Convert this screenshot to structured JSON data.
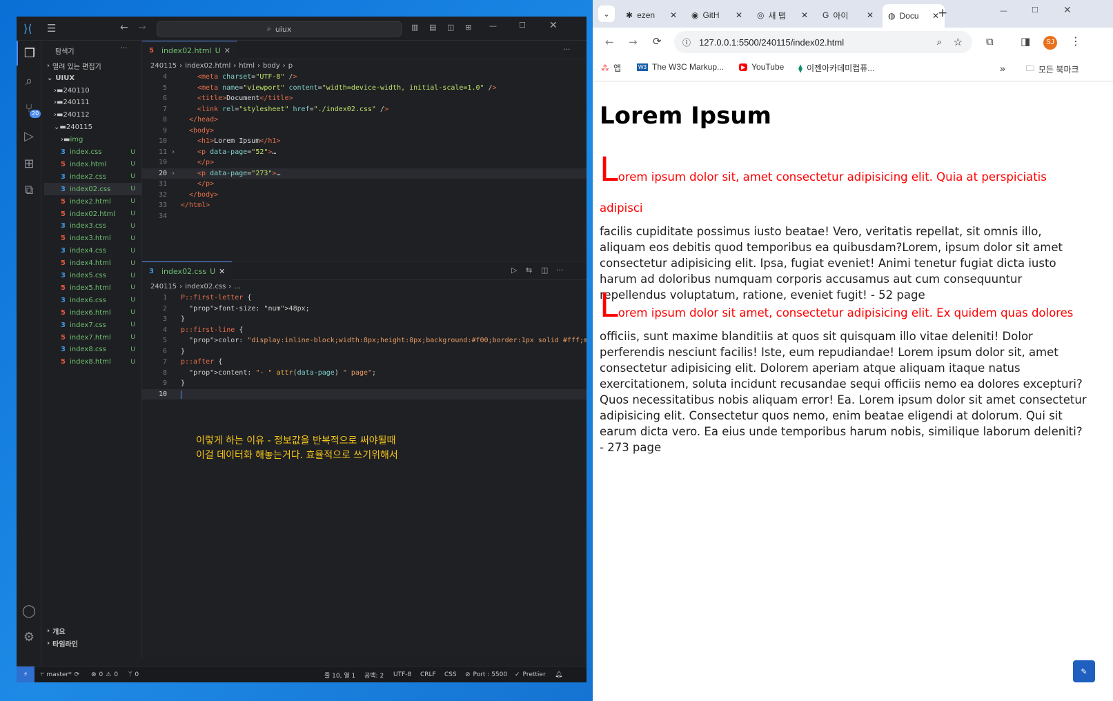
{
  "vscode": {
    "search_text": "uiux",
    "explorer_title": "탐색기",
    "open_editors": "열려 있는 편집기",
    "root": "UIUX",
    "tree": [
      {
        "name": "240110",
        "kind": "folder"
      },
      {
        "name": "240111",
        "kind": "folder"
      },
      {
        "name": "240112",
        "kind": "folder"
      },
      {
        "name": "240115",
        "kind": "folder-open"
      },
      {
        "name": "img",
        "kind": "folder"
      },
      {
        "name": "index.css",
        "kind": "css",
        "status": "U"
      },
      {
        "name": "index.html",
        "kind": "html",
        "status": "U"
      },
      {
        "name": "index2.css",
        "kind": "css",
        "status": "U"
      },
      {
        "name": "index02.css",
        "kind": "css",
        "status": "U"
      },
      {
        "name": "index2.html",
        "kind": "html",
        "status": "U"
      },
      {
        "name": "index02.html",
        "kind": "html",
        "status": "U"
      },
      {
        "name": "index3.css",
        "kind": "css",
        "status": "U"
      },
      {
        "name": "index3.html",
        "kind": "html",
        "status": "U"
      },
      {
        "name": "index4.css",
        "kind": "css",
        "status": "U"
      },
      {
        "name": "index4.html",
        "kind": "html",
        "status": "U"
      },
      {
        "name": "index5.css",
        "kind": "css",
        "status": "U"
      },
      {
        "name": "index5.html",
        "kind": "html",
        "status": "U"
      },
      {
        "name": "index6.css",
        "kind": "css",
        "status": "U"
      },
      {
        "name": "index6.html",
        "kind": "html",
        "status": "U"
      },
      {
        "name": "index7.css",
        "kind": "css",
        "status": "U"
      },
      {
        "name": "index7.html",
        "kind": "html",
        "status": "U"
      },
      {
        "name": "index8.css",
        "kind": "css",
        "status": "U"
      },
      {
        "name": "index8.html",
        "kind": "html",
        "status": "U"
      }
    ],
    "outline": "개요",
    "timeline": "타임라인",
    "editor1": {
      "tab": "index02.html",
      "tab_status": "U",
      "crumbs": [
        "240115",
        "index02.html",
        "html",
        "body",
        "p"
      ],
      "lines": [
        {
          "n": "4",
          "html": "<meta charset=\"UTF-8\" />"
        },
        {
          "n": "5",
          "html": "<meta name=\"viewport\" content=\"width=device-width, initial-scale=1.0\" />"
        },
        {
          "n": "6",
          "html": "<title>Document</title>"
        },
        {
          "n": "7",
          "html": "<link rel=\"stylesheet\" href=\"./index02.css\" />"
        },
        {
          "n": "8",
          "html": "</head>"
        },
        {
          "n": "9",
          "html": "<body>"
        },
        {
          "n": "10",
          "html": "<h1>Lorem Ipsum</h1>"
        },
        {
          "n": "11",
          "html": "<p data-page=\"52\">…"
        },
        {
          "n": "19",
          "html": "</p>"
        },
        {
          "n": "20",
          "html": "<p data-page=\"273\">…"
        },
        {
          "n": "31",
          "html": "</p>"
        },
        {
          "n": "32",
          "html": "</body>"
        },
        {
          "n": "33",
          "html": "</html>"
        },
        {
          "n": "34",
          "html": ""
        }
      ]
    },
    "editor2": {
      "tab": "index02.css",
      "tab_status": "U",
      "crumbs": [
        "240115",
        "index02.css",
        "..."
      ],
      "lines": [
        {
          "n": "1",
          "text": "P::first-letter {"
        },
        {
          "n": "2",
          "text": "  font-size: 48px;"
        },
        {
          "n": "3",
          "text": "}"
        },
        {
          "n": "4",
          "text": "p::first-line {"
        },
        {
          "n": "5",
          "text": "  color: #f00;"
        },
        {
          "n": "6",
          "text": "}"
        },
        {
          "n": "7",
          "text": "p::after {"
        },
        {
          "n": "8",
          "text": "  content: \"- \" attr(data-page) \" page\";"
        },
        {
          "n": "9",
          "text": "}"
        },
        {
          "n": "10",
          "text": ""
        }
      ]
    },
    "note_line1": "이렇게 하는 이유 - 정보값을 반복적으로 써야될때",
    "note_line2": "이걸 데이터화 해놓는거다. 효율적으로 쓰기위해서",
    "status": {
      "branch": "master*",
      "errors": "0",
      "warnings": "0",
      "ports": "0",
      "position": "줄 10, 열 1",
      "spaces": "공백: 2",
      "encoding": "UTF-8",
      "eol": "CRLF",
      "language": "CSS",
      "port": "Port : 5500",
      "formatter": "Prettier"
    },
    "scm_badge": "20"
  },
  "chrome": {
    "tabs": [
      "ezen",
      "GitH",
      "새 탭",
      "아이",
      "Docu"
    ],
    "url": "127.0.0.1:5500/240115/index02.html",
    "avatar": "SJ",
    "bookmarks": [
      "앱",
      "The W3C Markup...",
      "YouTube",
      "이젠아카데미컴퓨..."
    ],
    "all_bookmarks": "모든 북마크",
    "page": {
      "h1": "Lorem Ipsum",
      "p1_first": "L",
      "p1_line1": "orem ipsum dolor sit, amet consectetur adipisicing elit. Quia at perspiciatis adipisci",
      "p1_rest": "facilis cupiditate possimus iusto beatae! Vero, veritatis repellat, sit omnis illo, aliquam eos debitis quod temporibus ea quibusdam?Lorem, ipsum dolor sit amet consectetur adipisicing elit. Ipsa, fugiat eveniet! Animi tenetur fugiat dicta iusto harum ad doloribus numquam corporis accusamus aut cum consequuntur repellendus voluptatum, ratione, eveniet fugit! - 52 page",
      "p2_first": "L",
      "p2_line1": "orem ipsum dolor sit amet, consectetur adipisicing elit. Ex quidem quas dolores",
      "p2_rest": "officiis, sunt maxime blanditiis at quos sit quisquam illo vitae deleniti! Dolor perferendis nesciunt facilis! Iste, eum repudiandae! Lorem ipsum dolor sit, amet consectetur adipisicing elit. Dolorem aperiam atque aliquam itaque natus exercitationem, soluta incidunt recusandae sequi officiis nemo ea dolores excepturi? Quos necessitatibus nobis aliquam error! Ea. Lorem ipsum dolor sit amet consectetur adipisicing elit. Consectetur quos nemo, enim beatae eligendi at dolorum. Qui sit earum dicta vero. Ea eius unde temporibus harum nobis, similique laborum deleniti? - 273 page"
    }
  },
  "colors": {
    "accent": "#4f8cf2",
    "first_line": "#ff0000",
    "note": "#f5c518"
  }
}
